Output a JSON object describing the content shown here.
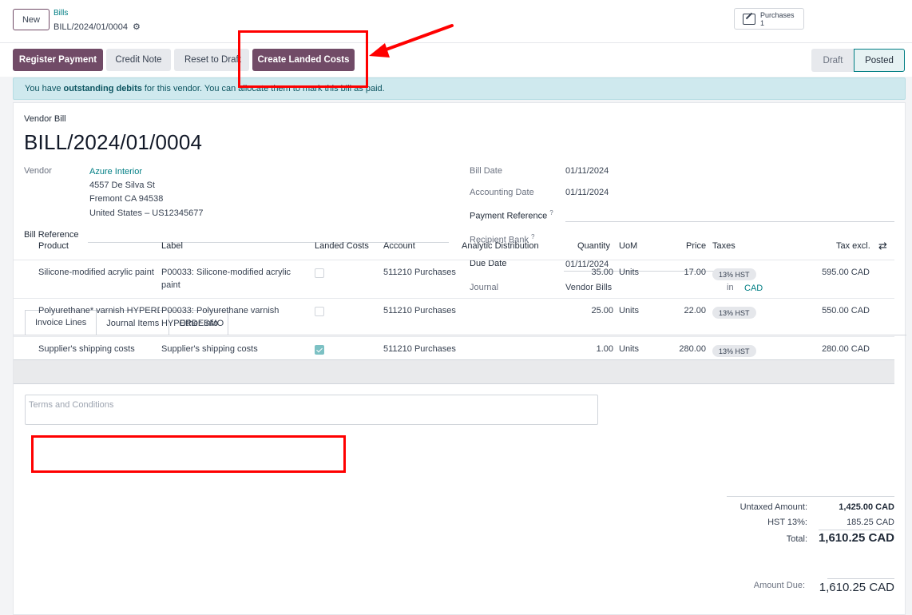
{
  "topbar": {
    "new_label": "New",
    "breadcrumb_parent": "Bills",
    "breadcrumb_current": "BILL/2024/01/0004",
    "smart_button": {
      "label": "Purchases",
      "count": "1"
    }
  },
  "actions": {
    "register_payment": "Register Payment",
    "credit_note": "Credit Note",
    "reset_to_draft": "Reset to Draft",
    "create_landed_costs": "Create Landed Costs"
  },
  "status": {
    "draft": "Draft",
    "posted": "Posted",
    "current": "Posted"
  },
  "alert": {
    "prefix": "You have",
    "bold": "outstanding debits",
    "suffix": "for this vendor. You can allocate them to mark this bill as paid."
  },
  "form": {
    "type_label": "Vendor Bill",
    "title": "BILL/2024/01/0004",
    "vendor_label": "Vendor",
    "vendor_name": "Azure Interior",
    "vendor_address1": "4557 De Silva St",
    "vendor_address2": "Fremont CA 94538",
    "vendor_address3": "United States – US12345677",
    "bill_reference_label": "Bill Reference",
    "bill_date_label": "Bill Date",
    "bill_date": "01/11/2024",
    "accounting_date_label": "Accounting Date",
    "accounting_date": "01/11/2024",
    "payment_reference_label": "Payment Reference",
    "recipient_bank_label": "Recipient Bank",
    "due_date_label": "Due Date",
    "due_date": "01/11/2024",
    "journal_label": "Journal",
    "journal": "Vendor Bills",
    "in_label": "in",
    "currency": "CAD",
    "help_mark": "?"
  },
  "tabs": [
    "Invoice Lines",
    "Journal Items",
    "Other Info"
  ],
  "table": {
    "headers": {
      "product": "Product",
      "label": "Label",
      "landed_costs": "Landed Costs",
      "account": "Account",
      "analytic": "Analytic Distribution",
      "quantity": "Quantity",
      "uom": "UoM",
      "price": "Price",
      "taxes": "Taxes",
      "tax_excl": "Tax excl."
    },
    "rows": [
      {
        "product": "Silicone-modified acrylic paint",
        "label1": "P00033: Silicone-modified acrylic",
        "label2": "paint",
        "landed": false,
        "account": "511210 Purchases",
        "quantity": "35.00",
        "uom": "Units",
        "price": "17.00",
        "tax": "13% HST",
        "subtotal": "595.00 CAD"
      },
      {
        "product": "Polyurethane* varnish HYPERD",
        "label1": "P00033: Polyurethane varnish",
        "label2": "HYPERDESMO",
        "landed": false,
        "account": "511210 Purchases",
        "quantity": "25.00",
        "uom": "Units",
        "price": "22.00",
        "tax": "13% HST",
        "subtotal": "550.00 CAD"
      },
      {
        "product": "Supplier's shipping costs",
        "label1": "Supplier's shipping costs",
        "label2": "",
        "landed": true,
        "account": "511210 Purchases",
        "quantity": "1.00",
        "uom": "Units",
        "price": "280.00",
        "tax": "13% HST",
        "subtotal": "280.00 CAD"
      }
    ]
  },
  "terms_placeholder": "Terms and Conditions",
  "totals": {
    "untaxed_label": "Untaxed Amount:",
    "untaxed": "1,425.00 CAD",
    "hst_label": "HST 13%:",
    "hst": "185.25 CAD",
    "total_label": "Total:",
    "total": "1,610.25 CAD",
    "amount_due_label": "Amount Due:",
    "amount_due": "1,610.25 CAD"
  },
  "colors": {
    "brand": "#714b67",
    "link": "#017e84",
    "annotation": "#ff0000"
  }
}
